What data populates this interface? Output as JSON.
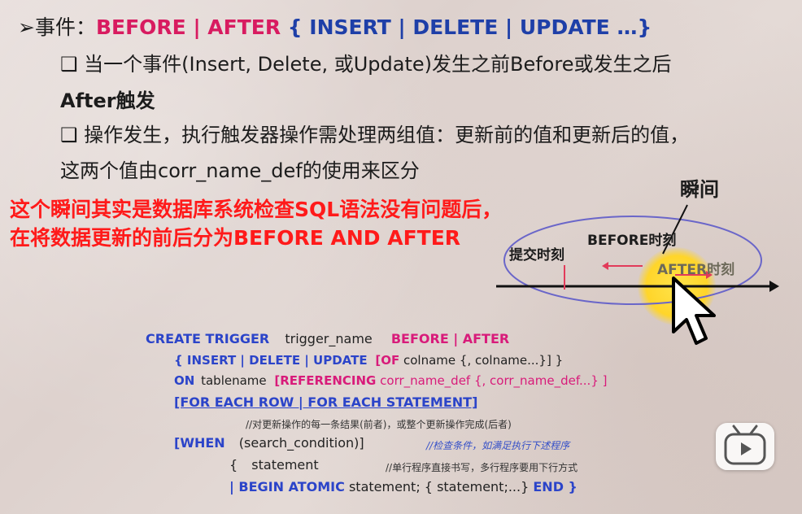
{
  "bullets": {
    "main_prefix": "➢事件：",
    "main_red": "BEFORE | AFTER",
    "main_blue": " { INSERT | DELETE | UPDATE  …}",
    "sub1_line1": "❑ 当一个事件(Insert, Delete, 或Update)发生之前Before或发生之后",
    "sub1_line2": "After触发",
    "sub2_line1": "❑ 操作发生，执行触发器操作需处理两组值：更新前的值和更新后的值，",
    "sub2_line2": "这两个值由corr_name_def的使用来区分"
  },
  "annotation": {
    "line1": "这个瞬间其实是数据库系统检查SQL语法没有问题后，",
    "line2": "在将数据更新的前后分为BEFORE AND AFTER"
  },
  "diagram": {
    "title": "瞬间",
    "before_label": "BEFORE时刻",
    "submit_label": "提交时刻",
    "after_label": "AFTER时刻"
  },
  "code": {
    "l1_a": "CREATE  TRIGGER",
    "l1_b": "trigger_name",
    "l1_c": "BEFORE | AFTER",
    "l2_a": "{ INSERT | DELETE | UPDATE",
    "l2_b": "[OF",
    "l2_c": "colname {, colname...}] }",
    "l3_a": "ON",
    "l3_b": "tablename",
    "l3_c": "[REFERENCING",
    "l3_d": "corr_name_def {, corr_name_def...} ]",
    "l4": "[FOR EACH ROW | FOR EACH STATEMENT]",
    "l4_comment": "//对更新操作的每一条结果(前者)，或整个更新操作完成(后者)",
    "l5_a": "[WHEN",
    "l5_b": "(search_condition)]",
    "l5_comment": "//检查条件，如满足执行下述程序",
    "l6_a": "{",
    "l6_b": "statement",
    "l6_comment": "//单行程序直接书写，多行程序要用下行方式",
    "l7_a": "| BEGIN ATOMIC",
    "l7_b": "statement; { statement;...}",
    "l7_c": "END }"
  },
  "icons": [
    "cursor-arrow-icon",
    "play-icon"
  ],
  "colors": {
    "red": "#d81b60",
    "blue": "#1e3fa8",
    "alert": "#ff1a1a",
    "code_blue": "#2b44c9",
    "code_magenta": "#d81b7a"
  }
}
